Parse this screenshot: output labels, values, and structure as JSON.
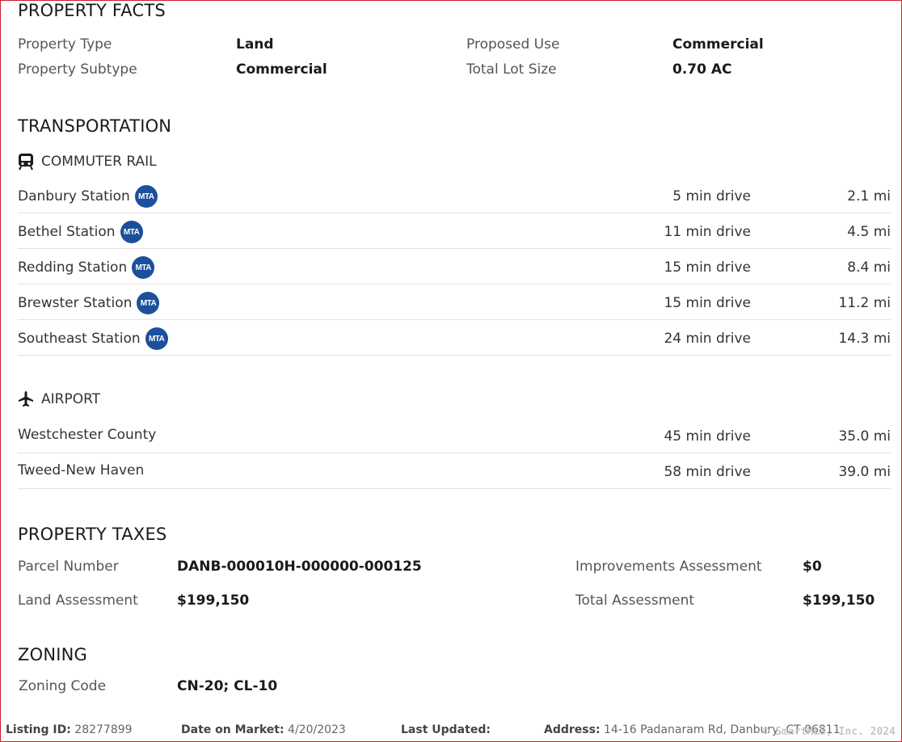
{
  "property_facts": {
    "title": "PROPERTY FACTS",
    "rows": [
      {
        "label": "Property Type",
        "value": "Land",
        "label2": "Proposed Use",
        "value2": "Commercial"
      },
      {
        "label": "Property Subtype",
        "value": "Commercial",
        "label2": "Total Lot Size",
        "value2": "0.70 AC"
      }
    ]
  },
  "transportation": {
    "title": "TRANSPORTATION",
    "rail": {
      "heading": "COMMUTER RAIL",
      "icon": "train-icon",
      "badge": "MTA",
      "stations": [
        {
          "name": "Danbury Station",
          "drive": "5 min drive",
          "distance": "2.1 mi"
        },
        {
          "name": "Bethel Station",
          "drive": "11 min drive",
          "distance": "4.5 mi"
        },
        {
          "name": "Redding Station",
          "drive": "15 min drive",
          "distance": "8.4 mi"
        },
        {
          "name": "Brewster Station",
          "drive": "15 min drive",
          "distance": "11.2 mi"
        },
        {
          "name": "Southeast Station",
          "drive": "24 min drive",
          "distance": "14.3 mi"
        }
      ]
    },
    "airport": {
      "heading": "AIRPORT",
      "icon": "airplane-icon",
      "airports": [
        {
          "name": "Westchester County",
          "drive": "45 min drive",
          "distance": "35.0 mi"
        },
        {
          "name": "Tweed-New Haven",
          "drive": "58 min drive",
          "distance": "39.0 mi"
        }
      ]
    }
  },
  "property_taxes": {
    "title": "PROPERTY TAXES",
    "parcel_label": "Parcel Number",
    "parcel_value": "DANB-000010H-000000-000125",
    "improvements_label": "Improvements Assessment",
    "improvements_value": "$0",
    "land_label": "Land Assessment",
    "land_value": "$199,150",
    "total_label": "Total Assessment",
    "total_value": "$199,150"
  },
  "zoning": {
    "title": "ZONING",
    "code_label": "Zoning Code",
    "code_value": "CN-20; CL-10"
  },
  "footer": {
    "listing_label": "Listing ID:",
    "listing_value": "28277899",
    "market_label": "Date on Market:",
    "market_value": "4/20/2023",
    "updated_label": "Last Updated:",
    "updated_value": "",
    "address_label": "Address:",
    "address_value": "14-16 Padanaram Rd, Danbury, CT 06811",
    "watermark": "© SmartMLS, Inc. 2024"
  },
  "colors": {
    "border": "#c8202a",
    "mta_badge": "#1c4f9c"
  }
}
